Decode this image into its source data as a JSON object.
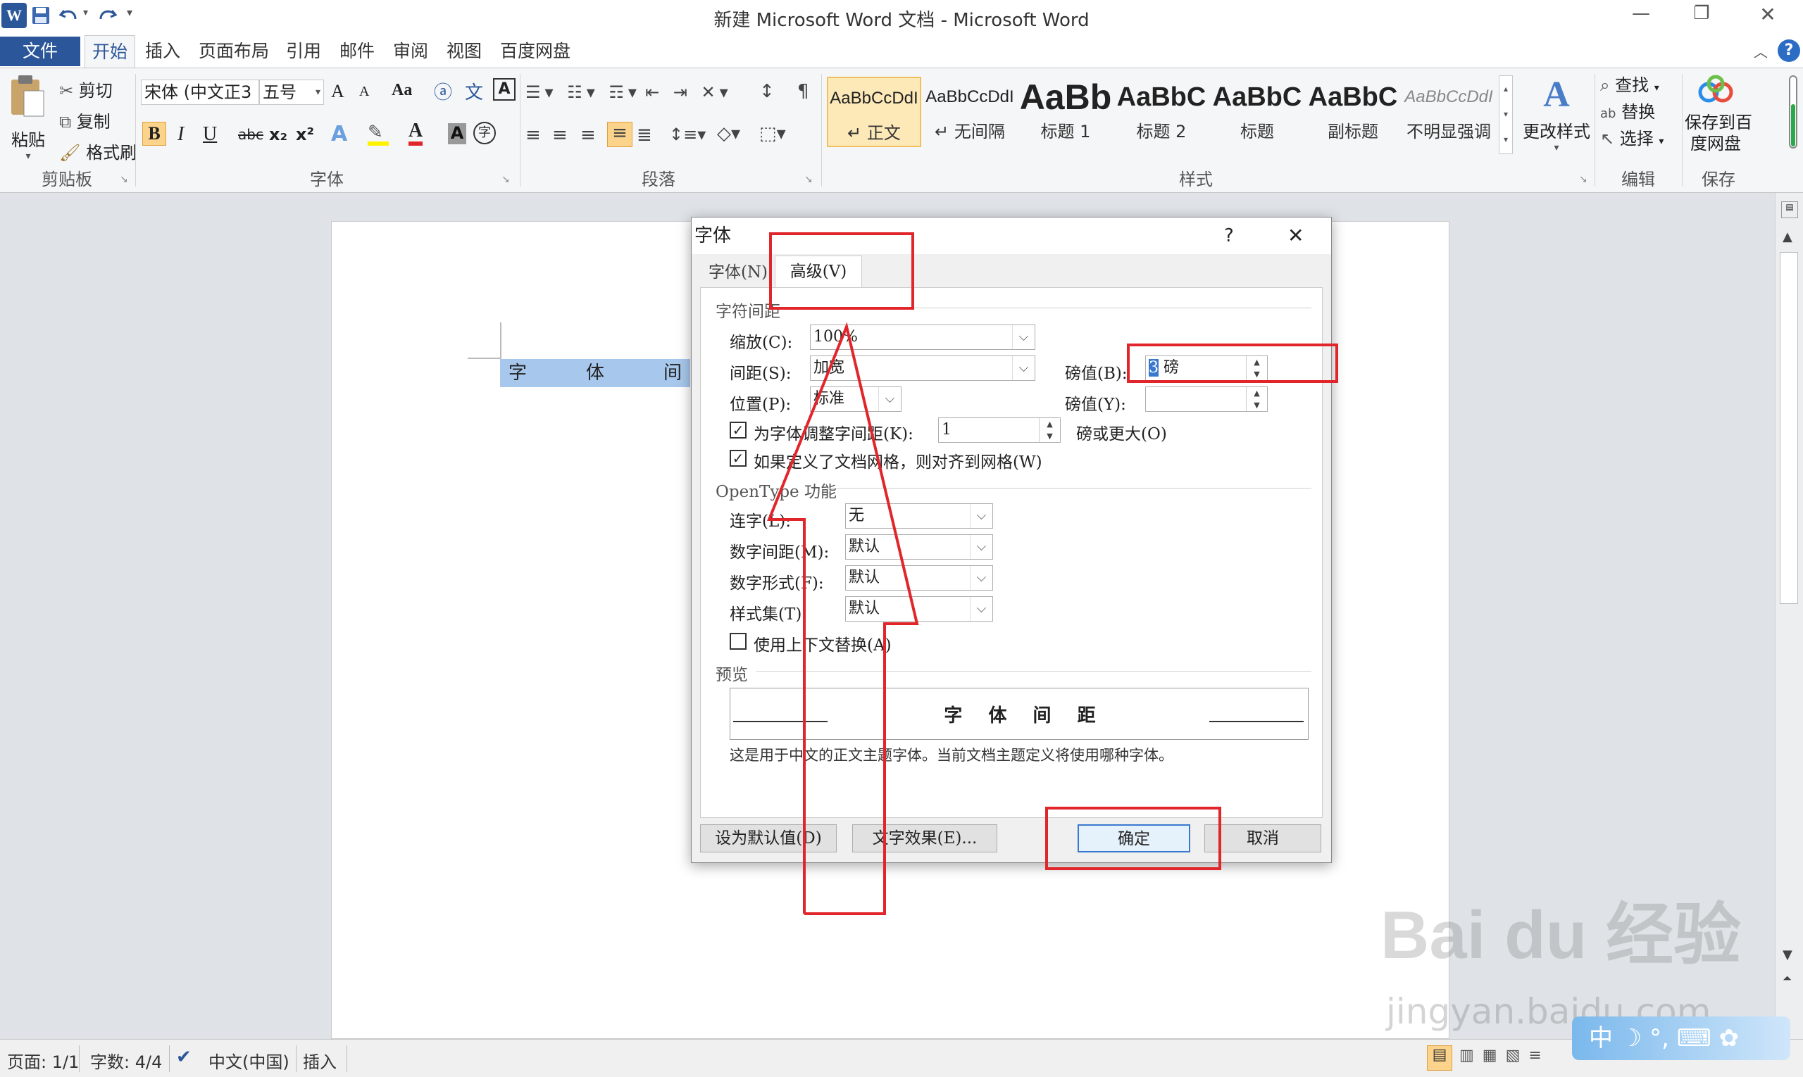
{
  "window": {
    "title": "新建 Microsoft Word 文档 - Microsoft Word",
    "app_icon": "W",
    "controls": {
      "minimize": "—",
      "restore": "❐",
      "close": "✕"
    }
  },
  "tabs": {
    "file": "文件",
    "items": [
      "开始",
      "插入",
      "页面布局",
      "引用",
      "邮件",
      "审阅",
      "视图",
      "百度网盘"
    ],
    "active": "开始"
  },
  "ribbon": {
    "clipboard": {
      "paste": "粘贴",
      "cut": "剪切",
      "copy": "复制",
      "format_painter": "格式刷",
      "group": "剪贴板"
    },
    "font": {
      "name": "宋体 (中文正3",
      "size": "五号",
      "group": "字体",
      "grow": "A",
      "shrink": "A",
      "change_case": "Aa",
      "bold": "B",
      "italic": "I",
      "underline": "U",
      "strike": "abc",
      "sub": "x₂",
      "sup": "x²",
      "text_effect": "A",
      "highlight": "✎",
      "font_color": "A",
      "char_shading": "A",
      "enclose": "字"
    },
    "paragraph": {
      "group": "段落"
    },
    "styles": {
      "group": "样式",
      "items": [
        {
          "sample": "AaBbCcDdI",
          "name": "正文",
          "prefix": "↵"
        },
        {
          "sample": "AaBbCcDdI",
          "name": "无间隔",
          "prefix": "↵"
        },
        {
          "sample": "AaBb",
          "name": "标题 1",
          "prefix": ""
        },
        {
          "sample": "AaBbC",
          "name": "标题 2",
          "prefix": ""
        },
        {
          "sample": "AaBbC",
          "name": "标题",
          "prefix": ""
        },
        {
          "sample": "AaBbC",
          "name": "副标题",
          "prefix": ""
        },
        {
          "sample": "AaBbCcDdI",
          "name": "不明显强调",
          "prefix": ""
        }
      ],
      "change_styles": "更改样式"
    },
    "editing": {
      "group": "编辑",
      "find": "查找",
      "replace": "替换",
      "select": "选择"
    },
    "save": {
      "group": "保存",
      "label": "保存到百度网盘",
      "line1": "保存到百",
      "line2": "度网盘"
    }
  },
  "document": {
    "chars": [
      "字",
      "体",
      "间"
    ]
  },
  "dialog": {
    "title": "字体",
    "help": "?",
    "close": "✕",
    "tabs": [
      "字体(N)",
      "高级(V)"
    ],
    "active_tab": "高级(V)",
    "section_spacing": "字符间距",
    "scale": {
      "label": "缩放(C):",
      "value": "100%"
    },
    "spacing": {
      "label": "间距(S):",
      "value": "加宽",
      "by_label": "磅值(B):",
      "by_value": "3 磅",
      "by_value_selected": "3",
      "by_value_rest": " 磅"
    },
    "position": {
      "label": "位置(P):",
      "value": "标准",
      "by_label": "磅值(Y):",
      "by_value": ""
    },
    "kerning": {
      "label": "为字体调整字间距(K):",
      "value": "1",
      "suffix": "磅或更大(O)",
      "checked": true
    },
    "snap_grid": {
      "label": "如果定义了文档网格，则对齐到网格(W)",
      "checked": true
    },
    "section_opentype": "OpenType 功能",
    "ligatures": {
      "label": "连字(L):",
      "value": "无"
    },
    "number_spacing": {
      "label": "数字间距(M):",
      "value": "默认"
    },
    "number_forms": {
      "label": "数字形式(F):",
      "value": "默认"
    },
    "stylistic_sets": {
      "label": "样式集(T):",
      "value": "默认"
    },
    "contextual": {
      "label": "使用上下文替换(A)",
      "checked": false
    },
    "section_preview": "预览",
    "preview_text": "字 体 间 距",
    "preview_note": "这是用于中文的正文主题字体。当前文档主题定义将使用哪种字体。",
    "buttons": {
      "set_default": "设为默认值(D)",
      "text_effects": "文字效果(E)...",
      "ok": "确定",
      "cancel": "取消"
    }
  },
  "status": {
    "page": "页面: 1/1",
    "words": "字数: 4/4",
    "language": "中文(中国)",
    "mode": "插入"
  },
  "watermark": {
    "brand": "Bai du 经验",
    "url": "jingyan.baidu.com"
  },
  "ime": {
    "label": "中"
  },
  "colors": {
    "accent": "#2b579a",
    "annotation": "#e0262a",
    "selection": "#a7c8ec"
  }
}
